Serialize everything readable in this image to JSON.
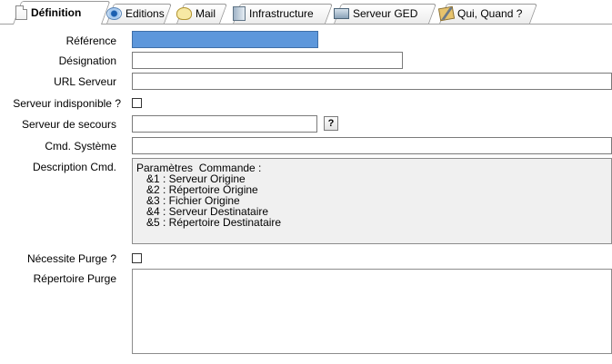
{
  "tabs": [
    {
      "label": "Définition",
      "icon": "document-icon",
      "active": true
    },
    {
      "label": "Editions",
      "icon": "view-icon",
      "active": false
    },
    {
      "label": "Mail",
      "icon": "mail-icon",
      "active": false
    },
    {
      "label": "Infrastructure",
      "icon": "server-icon",
      "active": false
    },
    {
      "label": "Serveur GED",
      "icon": "storage-icon",
      "active": false
    },
    {
      "label": "Qui, Quand ?",
      "icon": "tools-icon",
      "active": false
    }
  ],
  "form": {
    "reference": {
      "label": "Référence",
      "value": ""
    },
    "designation": {
      "label": "Désignation",
      "value": ""
    },
    "url_serveur": {
      "label": "URL Serveur",
      "value": ""
    },
    "serveur_indisponible": {
      "label": "Serveur indisponible ?",
      "checked": false
    },
    "serveur_secours": {
      "label": "Serveur de secours",
      "value": "",
      "help_label": "?"
    },
    "cmd_systeme": {
      "label": "Cmd. Système",
      "value": ""
    },
    "description_cmd": {
      "label": "Description Cmd.",
      "lines": [
        "Paramètres  Commande :",
        "&1 : Serveur Origine",
        "&2 : Répertoire Origine",
        "&3 : Fichier Origine",
        "&4 : Serveur Destinataire",
        "&5 : Répertoire Destinataire"
      ]
    },
    "necessite_purge": {
      "label": "Nécessite Purge ?",
      "checked": false
    },
    "repertoire_purge": {
      "label": "Répertoire Purge",
      "value": ""
    }
  },
  "colors": {
    "selection": "#5d97db"
  }
}
